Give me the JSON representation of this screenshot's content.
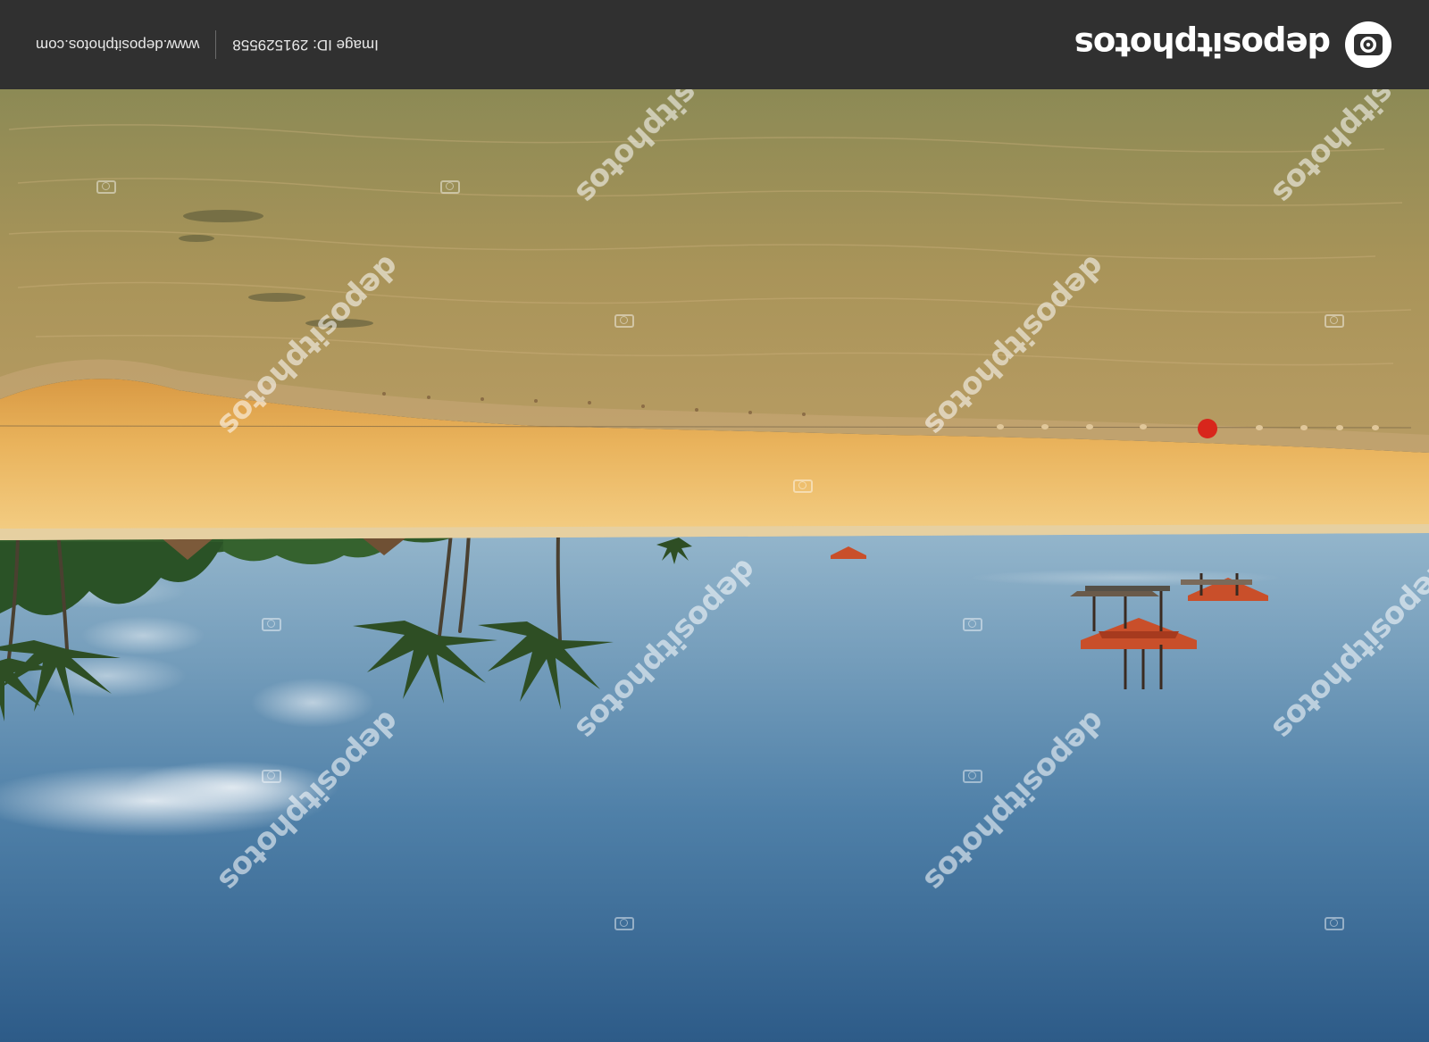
{
  "brand": {
    "name": "depositphotos",
    "logo_icon": "camera-lens-icon"
  },
  "footer": {
    "image_id_text": "Image ID: 291529558",
    "site_url": "www.depositphotos.com"
  },
  "watermark_text": "depositphotos",
  "colors": {
    "bar": "#303030",
    "sky_top": "#2f5e8c",
    "sky_bottom": "#8fb2c9",
    "sand": "#e8b25a",
    "sea": "#b49a62",
    "roof": "#c94f2a",
    "buoy": "#d8261c"
  }
}
